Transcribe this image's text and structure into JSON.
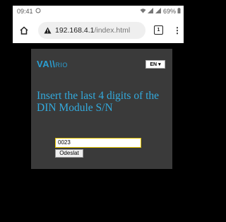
{
  "status_bar": {
    "time": "09:41",
    "battery": "69%"
  },
  "browser": {
    "url_host": "192.168.4.1",
    "url_path": "/index.html",
    "tab_count": "1"
  },
  "page": {
    "logo": {
      "main": "VA\\\\",
      "sub": "RIO"
    },
    "language": "EN",
    "headline": "Insert the last 4 digits of the DIN Module S/N",
    "serial_input": {
      "value": "0023"
    },
    "submit_label": "Odeslat"
  },
  "colors": {
    "accent": "#33aadd",
    "card_bg": "#3a3a3a",
    "page_bg": "#000000"
  }
}
